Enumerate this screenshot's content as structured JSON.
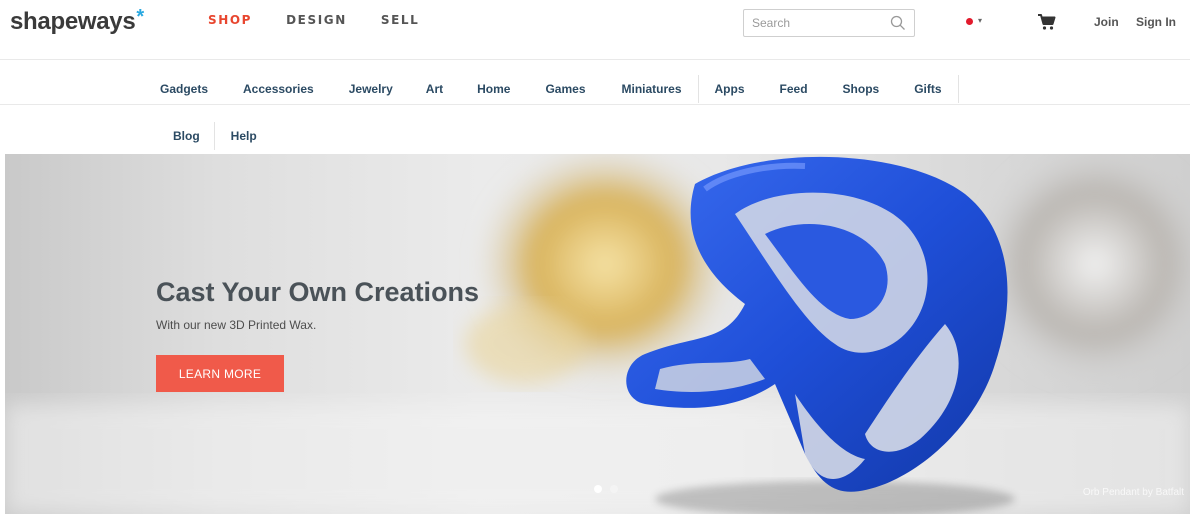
{
  "header": {
    "logo_text": "shapeways",
    "logo_star": "*",
    "nav": [
      {
        "label": "SHOP",
        "active": true
      },
      {
        "label": "DESIGN",
        "active": false
      },
      {
        "label": "SELL",
        "active": false
      }
    ],
    "search": {
      "placeholder": "Search",
      "value": ""
    },
    "flag_caret": "▾",
    "join_label": "Join",
    "signin_label": "Sign In"
  },
  "categories": [
    "Gadgets",
    "Accessories",
    "Jewelry",
    "Art",
    "Home",
    "Games",
    "Miniatures",
    "Apps",
    "Feed",
    "Shops",
    "Gifts"
  ],
  "subnav": [
    "Blog",
    "Help"
  ],
  "hero": {
    "title": "Cast Your Own Creations",
    "subtitle": "With our new 3D Printed Wax.",
    "button_label": "LEARN MORE",
    "credit": "Orb Pendant by Batfalt",
    "slide_count": 2,
    "active_slide": 0
  },
  "colors": {
    "accent": "#e8462f",
    "button": "#f05a4a",
    "category_text": "#2b4a63",
    "logo_star": "#29a8e0",
    "hero_object": "#1f4fd8"
  },
  "icons": [
    "search-icon",
    "flag-icon",
    "cart-icon"
  ]
}
